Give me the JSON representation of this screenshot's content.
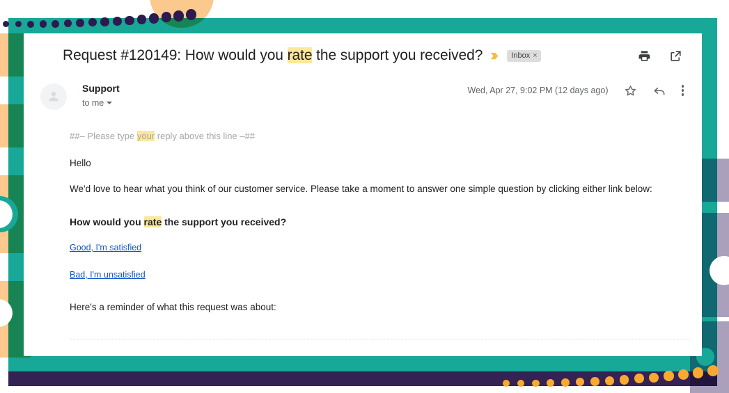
{
  "theme": {
    "teal": "#17a898",
    "deep_purple": "#342254",
    "peach": "#fbc88d",
    "lavender": "#aaa0bc",
    "dot_purple": "#2e1a4f",
    "dot_orange": "#f9a931",
    "highlight": "#fde79a",
    "link_blue": "#1155cc"
  },
  "email": {
    "subject_parts": {
      "before": "Request #120149: How would you ",
      "highlight": "rate",
      "after": " the support you received?"
    },
    "important_marker": "important-chevron-icon",
    "label_chip": {
      "name": "Inbox",
      "remove": "×"
    },
    "actions": {
      "print": "print-icon",
      "open_in_new": "open-in-new-window-icon"
    },
    "sender": {
      "name": "Support",
      "recipient": "to me",
      "avatar": "default-avatar-icon"
    },
    "timestamp": "Wed, Apr 27, 9:02 PM (12 days ago)",
    "message_actions": {
      "star": "star-icon",
      "reply": "reply-arrow-icon",
      "more": "more-options-icon"
    },
    "body": {
      "reply_line": {
        "before": "##– Please type ",
        "highlight": "your",
        "after": " reply above this line –##"
      },
      "greeting": "Hello",
      "intro": "We'd love to hear what you think of our customer service. Please take a moment to answer one simple question by clicking either link below:",
      "question": {
        "before": "How would you ",
        "highlight": "rate",
        "after": " the support you received?"
      },
      "links": [
        {
          "label": "Good, I'm satisfied"
        },
        {
          "label": "Bad, I'm unsatisfied"
        }
      ],
      "reminder": "Here's a reminder of what this request was about:"
    }
  }
}
